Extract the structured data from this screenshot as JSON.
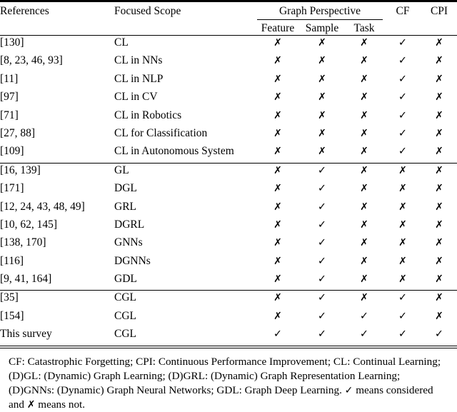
{
  "table": {
    "columns": {
      "references": "References",
      "focused_scope": "Focused Scope",
      "group_header": "Graph Perspective",
      "feature": "Feature",
      "sample": "Sample",
      "task": "Task",
      "cf": "CF",
      "cpi": "CPI"
    },
    "marks": {
      "yes": "✓",
      "no": "✗"
    },
    "groups": [
      {
        "name": "continual-learning-surveys",
        "rows": [
          {
            "references": "[130]",
            "scope": "CL",
            "feature": "no",
            "sample": "no",
            "task": "no",
            "cf": "yes",
            "cpi": "no",
            "bold": false
          },
          {
            "references": "[8, 23, 46, 93]",
            "scope": "CL in NNs",
            "feature": "no",
            "sample": "no",
            "task": "no",
            "cf": "yes",
            "cpi": "no",
            "bold": false
          },
          {
            "references": "[11]",
            "scope": "CL in NLP",
            "feature": "no",
            "sample": "no",
            "task": "no",
            "cf": "yes",
            "cpi": "no",
            "bold": false
          },
          {
            "references": "[97]",
            "scope": "CL in CV",
            "feature": "no",
            "sample": "no",
            "task": "no",
            "cf": "yes",
            "cpi": "no",
            "bold": false
          },
          {
            "references": "[71]",
            "scope": "CL in Robotics",
            "feature": "no",
            "sample": "no",
            "task": "no",
            "cf": "yes",
            "cpi": "no",
            "bold": false
          },
          {
            "references": "[27, 88]",
            "scope": "CL for Classification",
            "feature": "no",
            "sample": "no",
            "task": "no",
            "cf": "yes",
            "cpi": "no",
            "bold": false
          },
          {
            "references": "[109]",
            "scope": "CL in Autonomous System",
            "feature": "no",
            "sample": "no",
            "task": "no",
            "cf": "yes",
            "cpi": "no",
            "bold": false
          }
        ]
      },
      {
        "name": "graph-learning-surveys",
        "rows": [
          {
            "references": "[16, 139]",
            "scope": "GL",
            "feature": "no",
            "sample": "yes",
            "task": "no",
            "cf": "no",
            "cpi": "no",
            "bold": false
          },
          {
            "references": "[171]",
            "scope": "DGL",
            "feature": "no",
            "sample": "yes",
            "task": "no",
            "cf": "no",
            "cpi": "no",
            "bold": false
          },
          {
            "references": "[12, 24, 43, 48, 49]",
            "scope": "GRL",
            "feature": "no",
            "sample": "yes",
            "task": "no",
            "cf": "no",
            "cpi": "no",
            "bold": false
          },
          {
            "references": "[10, 62, 145]",
            "scope": "DGRL",
            "feature": "no",
            "sample": "yes",
            "task": "no",
            "cf": "no",
            "cpi": "no",
            "bold": false
          },
          {
            "references": "[138, 170]",
            "scope": "GNNs",
            "feature": "no",
            "sample": "yes",
            "task": "no",
            "cf": "no",
            "cpi": "no",
            "bold": false
          },
          {
            "references": "[116]",
            "scope": "DGNNs",
            "feature": "no",
            "sample": "yes",
            "task": "no",
            "cf": "no",
            "cpi": "no",
            "bold": false
          },
          {
            "references": "[9, 41, 164]",
            "scope": "GDL",
            "feature": "no",
            "sample": "yes",
            "task": "no",
            "cf": "no",
            "cpi": "no",
            "bold": false
          }
        ]
      },
      {
        "name": "continual-graph-learning-surveys",
        "rows": [
          {
            "references": "[35]",
            "scope": "CGL",
            "feature": "no",
            "sample": "yes",
            "task": "no",
            "cf": "yes",
            "cpi": "no",
            "bold": false
          },
          {
            "references": "[154]",
            "scope": "CGL",
            "feature": "no",
            "sample": "yes",
            "task": "yes",
            "cf": "yes",
            "cpi": "no",
            "bold": false
          },
          {
            "references": "This survey",
            "scope": "CGL",
            "feature": "yes",
            "sample": "yes",
            "task": "yes",
            "cf": "yes",
            "cpi": "yes",
            "bold": true
          }
        ]
      }
    ]
  },
  "footnote": {
    "text_part1": "CF: Catastrophic Forgetting; CPI: Continuous Performance Improvement; CL: Continual Learning; (D)GL: (Dynamic) Graph Learning; (D)GRL: (Dynamic) Graph Representation Learning; (D)GNNs: (Dynamic) Graph Neural Networks; GDL: Graph Deep Learning. ",
    "check_glyph": "✓",
    "text_part2": " means considered and ",
    "cross_glyph": "✗",
    "text_part3": " means not."
  }
}
